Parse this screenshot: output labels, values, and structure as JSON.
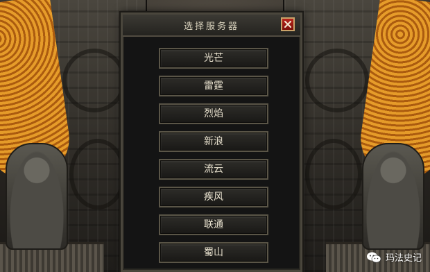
{
  "dialog": {
    "title": "选择服务器",
    "close_icon": "close-icon"
  },
  "servers": [
    {
      "label": "光芒"
    },
    {
      "label": "雷霆"
    },
    {
      "label": "烈焰"
    },
    {
      "label": "新浪"
    },
    {
      "label": "流云"
    },
    {
      "label": "疾风"
    },
    {
      "label": "联通"
    },
    {
      "label": "蜀山"
    }
  ],
  "watermark": {
    "icon": "wechat-icon",
    "text": "玛法史记"
  },
  "colors": {
    "dragon_gold": "#e8951e",
    "close_red": "#b8241c",
    "button_text": "#e9e2cf"
  }
}
